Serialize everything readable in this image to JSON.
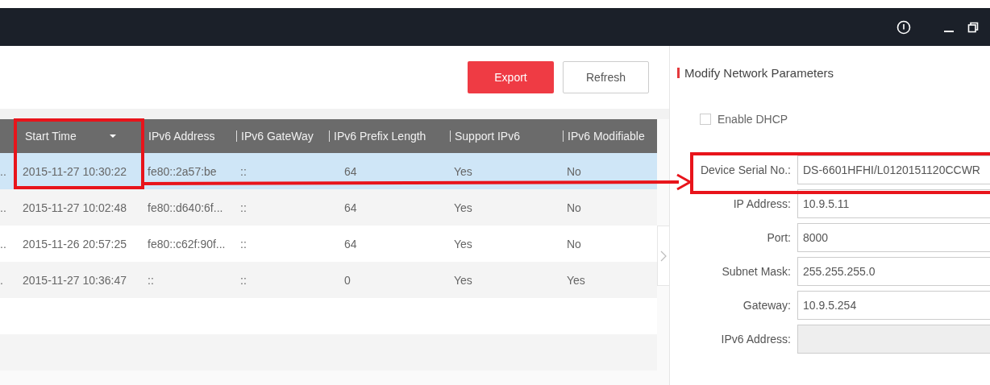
{
  "toolbar": {
    "buttons": [
      {
        "label": "Export",
        "kind": "primary"
      },
      {
        "label": "Refresh",
        "kind": "secondary"
      }
    ]
  },
  "table": {
    "columns": [
      {
        "label": "Start Time",
        "sorted": true
      },
      {
        "label": "IPv6 Address",
        "sorted": false
      },
      {
        "label": "IPv6 GateWay",
        "sorted": false
      },
      {
        "label": "IPv6 Prefix Length",
        "sorted": false
      },
      {
        "label": "Support IPv6",
        "sorted": false
      },
      {
        "label": "IPv6 Modifiable",
        "sorted": false
      }
    ],
    "rows": [
      {
        "column_1": "..",
        "cells": [
          "2015-11-27 10:30:22",
          "fe80::2a57:be",
          "::",
          "64",
          "Yes",
          "No"
        ],
        "selected": true
      },
      {
        "column_1": "..",
        "cells": [
          "2015-11-27 10:02:48",
          "fe80::d640:6f...",
          "::",
          "64",
          "Yes",
          "No"
        ],
        "selected": false
      },
      {
        "column_1": "..",
        "cells": [
          "2015-11-26 20:57:25",
          "fe80::c62f:90f...",
          "::",
          "64",
          "Yes",
          "No"
        ],
        "selected": false
      },
      {
        "column_1": ".",
        "cells": [
          "2015-11-27 10:36:47",
          "::",
          "::",
          "0",
          "Yes",
          "Yes"
        ],
        "selected": false
      }
    ]
  },
  "panel": {
    "title": "Modify Network Parameters",
    "dhcp": {
      "label": "Enable DHCP",
      "checked": false
    },
    "fields": [
      {
        "label": "Device Serial No.:",
        "value": "DS-6601HFHI/L0120151120CCWR",
        "disabled": false
      },
      {
        "label": "IP Address:",
        "value": "10.9.5.11",
        "disabled": false
      },
      {
        "label": "Port:",
        "value": "8000",
        "disabled": false
      },
      {
        "label": "Subnet Mask:",
        "value": "255.255.255.0",
        "disabled": false
      },
      {
        "label": "Gateway:",
        "value": "10.9.5.254",
        "disabled": false
      },
      {
        "label": "IPv6 Address:",
        "disabled": true
      }
    ]
  }
}
